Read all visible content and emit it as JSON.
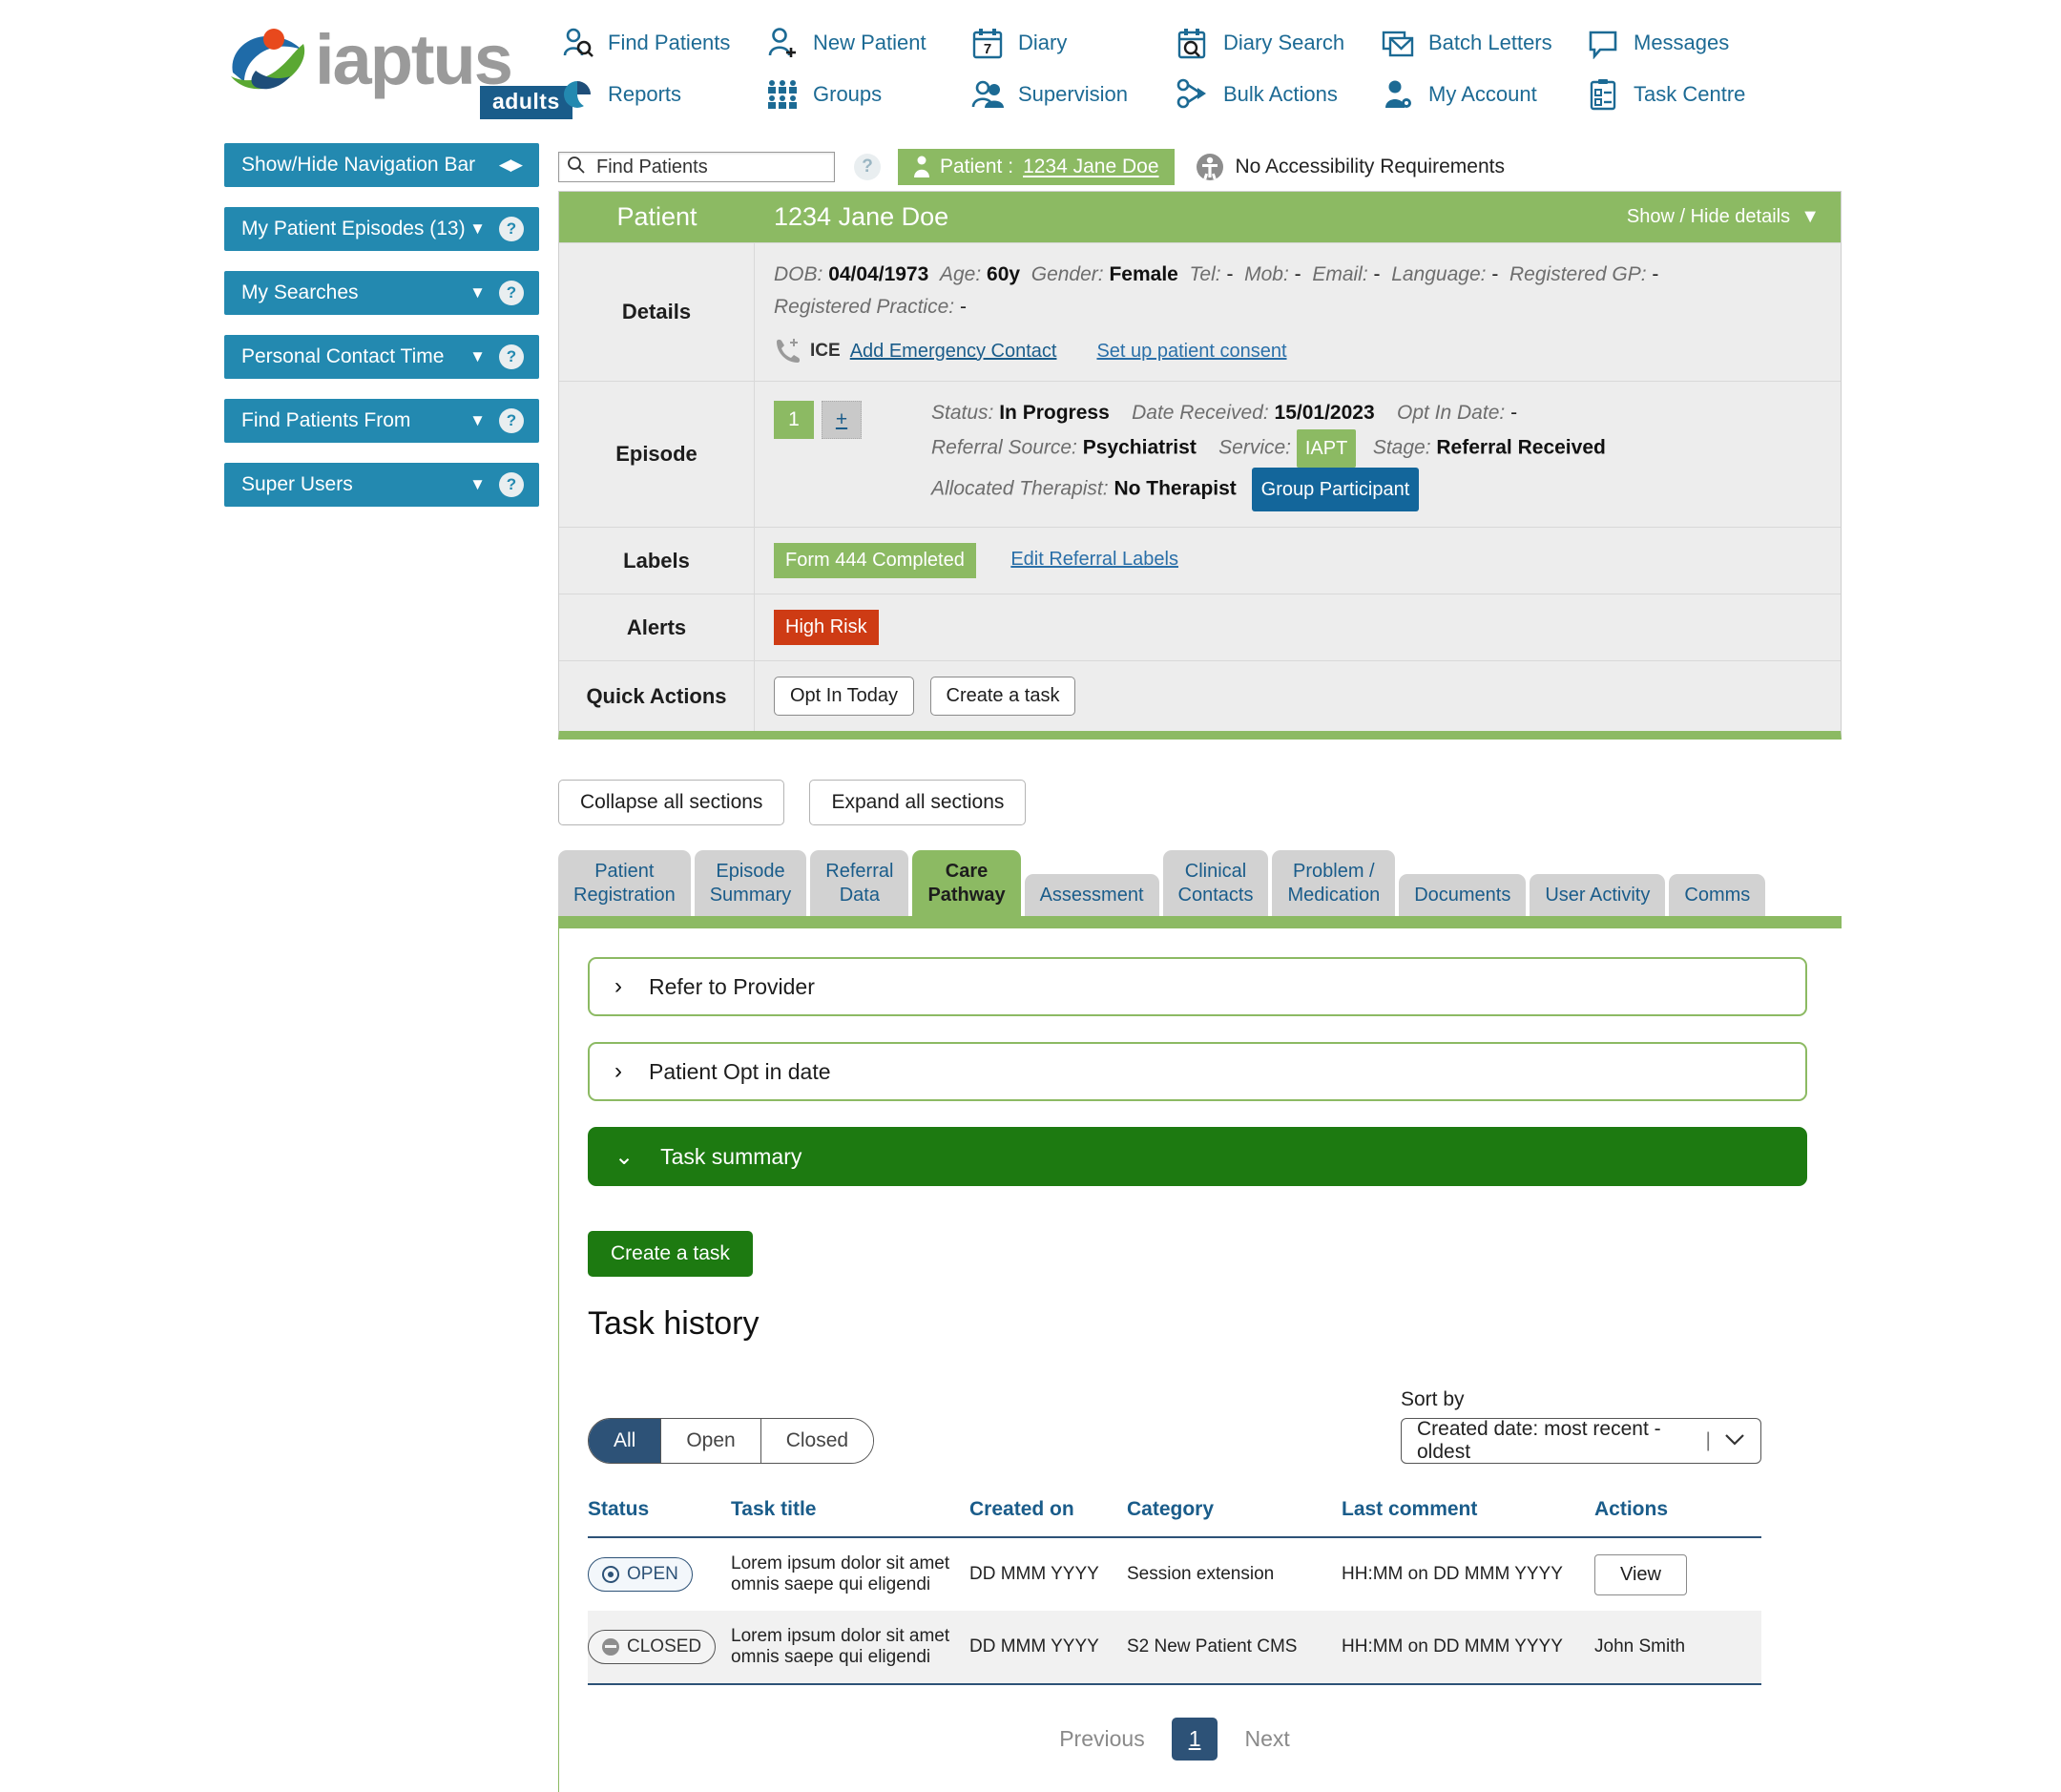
{
  "brand": {
    "name": "iaptus",
    "sub": "adults"
  },
  "topnav": {
    "row1": [
      {
        "label": "Find Patients",
        "icon": "find-patients-icon"
      },
      {
        "label": "New Patient",
        "icon": "new-patient-icon"
      },
      {
        "label": "Diary",
        "icon": "diary-icon",
        "icon_text": "7"
      },
      {
        "label": "Diary Search",
        "icon": "diary-search-icon"
      },
      {
        "label": "Batch Letters",
        "icon": "batch-letters-icon"
      },
      {
        "label": "Messages",
        "icon": "messages-icon"
      }
    ],
    "row2": [
      {
        "label": "Reports",
        "icon": "reports-icon"
      },
      {
        "label": "Groups",
        "icon": "groups-icon"
      },
      {
        "label": "Supervision",
        "icon": "supervision-icon"
      },
      {
        "label": "Bulk Actions",
        "icon": "bulk-actions-icon"
      },
      {
        "label": "My Account",
        "icon": "my-account-icon"
      },
      {
        "label": "Task Centre",
        "icon": "task-centre-icon"
      }
    ]
  },
  "sidebar": {
    "items": [
      {
        "label": "Show/Hide Navigation Bar",
        "control": "arrows"
      },
      {
        "label": "My Patient Episodes (13)",
        "control": "caret-help"
      },
      {
        "label": "My Searches",
        "control": "caret-help"
      },
      {
        "label": "Personal Contact Time",
        "control": "caret-help"
      },
      {
        "label": "Find Patients From",
        "control": "caret-help"
      },
      {
        "label": "Super Users",
        "control": "caret-help"
      }
    ]
  },
  "findbar": {
    "placeholder": "Find Patients",
    "value": "",
    "help": "?",
    "patient_prefix": "Patient :",
    "patient_name": "1234 Jane Doe",
    "accessibility": "No Accessibility Requirements"
  },
  "patient_card": {
    "header_left": "Patient",
    "header_title": "1234 Jane Doe",
    "show_hide": "Show / Hide details",
    "details_label": "Details",
    "details": {
      "dob_label": "DOB:",
      "dob": "04/04/1973",
      "age_label": "Age:",
      "age": "60y",
      "gender_label": "Gender:",
      "gender": "Female",
      "tel_label": "Tel:",
      "tel": "-",
      "mob_label": "Mob:",
      "mob": "-",
      "email_label": "Email:",
      "email": "-",
      "language_label": "Language:",
      "language": "-",
      "gp_label": "Registered GP:",
      "gp": "-",
      "practice_label": "Registered Practice:",
      "practice": "-",
      "ice_label": "ICE",
      "add_emergency_contact": "Add Emergency Contact",
      "set_up_consent": "Set up patient consent"
    },
    "episode_label": "Episode",
    "episode": {
      "number": "1",
      "add": "+",
      "status_label": "Status:",
      "status": "In Progress",
      "date_received_label": "Date Received:",
      "date_received": "15/01/2023",
      "opt_in_label": "Opt In Date:",
      "opt_in": "-",
      "referral_source_label": "Referral Source:",
      "referral_source": "Psychiatrist",
      "service_label": "Service:",
      "service": "IAPT",
      "stage_label": "Stage:",
      "stage": "Referral Received",
      "therapist_label": "Allocated Therapist:",
      "therapist": "No Therapist",
      "group_badge": "Group Participant"
    },
    "labels_label": "Labels",
    "labels": {
      "badge": "Form 444 Completed",
      "edit_link": "Edit Referral Labels"
    },
    "alerts_label": "Alerts",
    "alerts": {
      "badge": "High Risk"
    },
    "quick_actions_label": "Quick Actions",
    "quick_actions": [
      "Opt In Today",
      "Create a task"
    ]
  },
  "section_controls": {
    "collapse": "Collapse all sections",
    "expand": "Expand all sections"
  },
  "tabs": [
    {
      "line1": "Patient",
      "line2": "Registration",
      "active": false
    },
    {
      "line1": "Episode",
      "line2": "Summary",
      "active": false
    },
    {
      "line1": "Referral",
      "line2": "Data",
      "active": false
    },
    {
      "line1": "Care",
      "line2": "Pathway",
      "active": true
    },
    {
      "line1": "Assessment",
      "line2": "",
      "active": false
    },
    {
      "line1": "Clinical",
      "line2": "Contacts",
      "active": false
    },
    {
      "line1": "Problem /",
      "line2": "Medication",
      "active": false
    },
    {
      "line1": "Documents",
      "line2": "",
      "active": false
    },
    {
      "line1": "User Activity",
      "line2": "",
      "active": false
    },
    {
      "line1": "Comms",
      "line2": "",
      "active": false
    }
  ],
  "care_pathway": {
    "accordions": [
      {
        "title": "Refer to Provider",
        "open": false,
        "chevron": "›"
      },
      {
        "title": "Patient Opt in date",
        "open": false,
        "chevron": "›"
      },
      {
        "title": "Task summary",
        "open": true,
        "chevron": "⌄"
      }
    ],
    "create_task": "Create a task",
    "task_history_title": "Task history",
    "filters": [
      {
        "label": "All",
        "selected": true
      },
      {
        "label": "Open",
        "selected": false
      },
      {
        "label": "Closed",
        "selected": false
      }
    ],
    "sort": {
      "label": "Sort by",
      "value": "Created date: most recent - oldest"
    },
    "table": {
      "columns": [
        "Status",
        "Task title",
        "Created on",
        "Category",
        "Last comment",
        "Actions"
      ],
      "rows": [
        {
          "status": "OPEN",
          "title": "Lorem ipsum dolor sit amet omnis saepe qui eligendi",
          "created_on": "DD MMM YYYY",
          "category": "Session extension",
          "last_comment": "HH:MM on DD MMM YYYY",
          "action": "View",
          "action_type": "button"
        },
        {
          "status": "CLOSED",
          "title": "Lorem ipsum dolor sit amet omnis saepe qui eligendi",
          "created_on": "DD MMM YYYY",
          "category": "S2 New Patient CMS",
          "last_comment": "HH:MM on DD MMM YYYY",
          "action": "John Smith",
          "action_type": "text"
        }
      ]
    },
    "pagination": {
      "previous": "Previous",
      "page": "1",
      "next": "Next"
    }
  },
  "colors": {
    "teal": "#2389b0",
    "green": "#8cba63",
    "dark_green": "#1d7a11",
    "blue": "#1a5c8a",
    "navy": "#2d5277",
    "red": "#ce3b14"
  }
}
